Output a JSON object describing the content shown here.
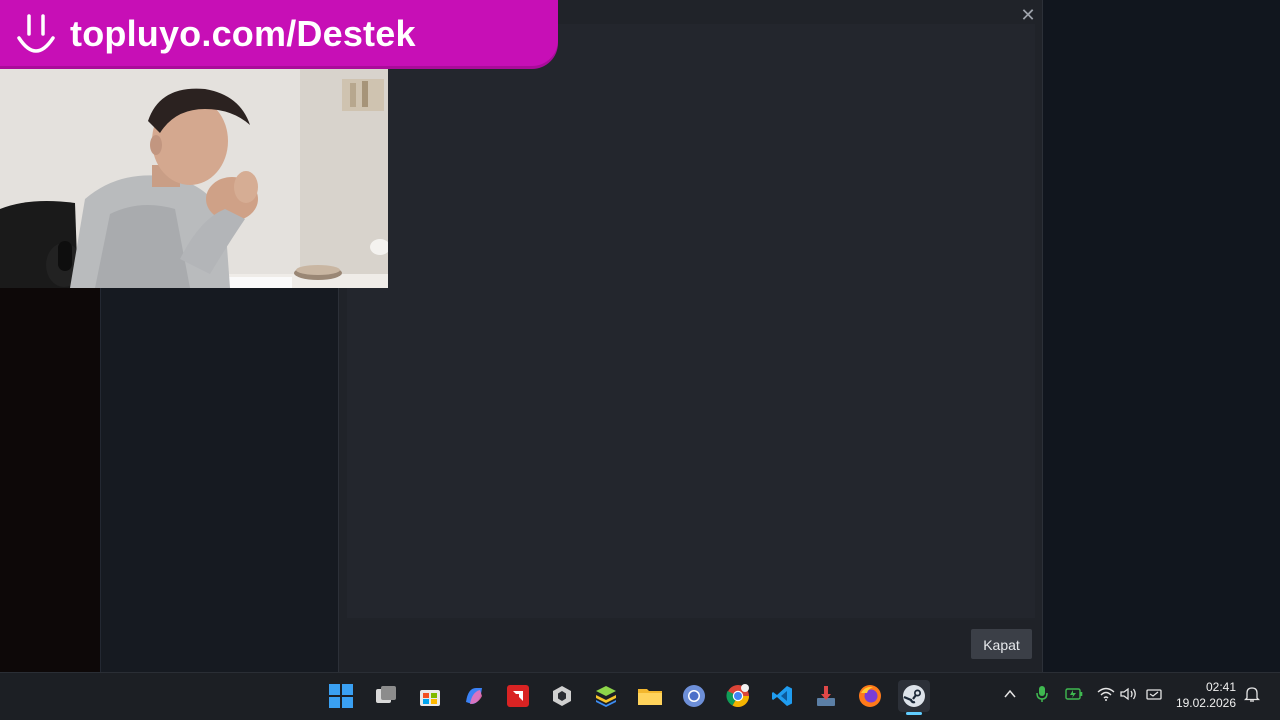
{
  "overlay": {
    "banner_text": "topluyo.com/Destek",
    "banner_color": "#c70fb6",
    "banner_icon": "smile-icon"
  },
  "modal": {
    "close_icon": "close-icon",
    "close_glyph": "✕",
    "button_label": "Kapat"
  },
  "taskbar": {
    "apps": [
      {
        "name": "start",
        "icon": "windows-logo-icon"
      },
      {
        "name": "task-view",
        "icon": "task-view-icon"
      },
      {
        "name": "microsoft-store",
        "icon": "store-icon"
      },
      {
        "name": "copilot",
        "icon": "copilot-icon"
      },
      {
        "name": "amd-software",
        "icon": "amd-icon"
      },
      {
        "name": "unity-hub",
        "icon": "unity-icon"
      },
      {
        "name": "bluestacks",
        "icon": "bluestacks-icon"
      },
      {
        "name": "file-explorer",
        "icon": "folder-icon"
      },
      {
        "name": "chrome-alt",
        "icon": "chrome-icon"
      },
      {
        "name": "chrome",
        "icon": "chrome-icon"
      },
      {
        "name": "vscode",
        "icon": "vscode-icon"
      },
      {
        "name": "installer",
        "icon": "download-icon"
      },
      {
        "name": "firefox",
        "icon": "firefox-icon"
      },
      {
        "name": "steam",
        "icon": "steam-icon"
      }
    ],
    "active_color": "#60cdff"
  },
  "tray": {
    "icons": [
      "chevron-up-icon",
      "microphone-icon",
      "battery-charging-icon",
      "wifi-icon",
      "volume-icon",
      "network-icon",
      "notification-icon"
    ],
    "mic_color": "#3fb950",
    "time": "02:41",
    "date": "19.02.2026"
  }
}
